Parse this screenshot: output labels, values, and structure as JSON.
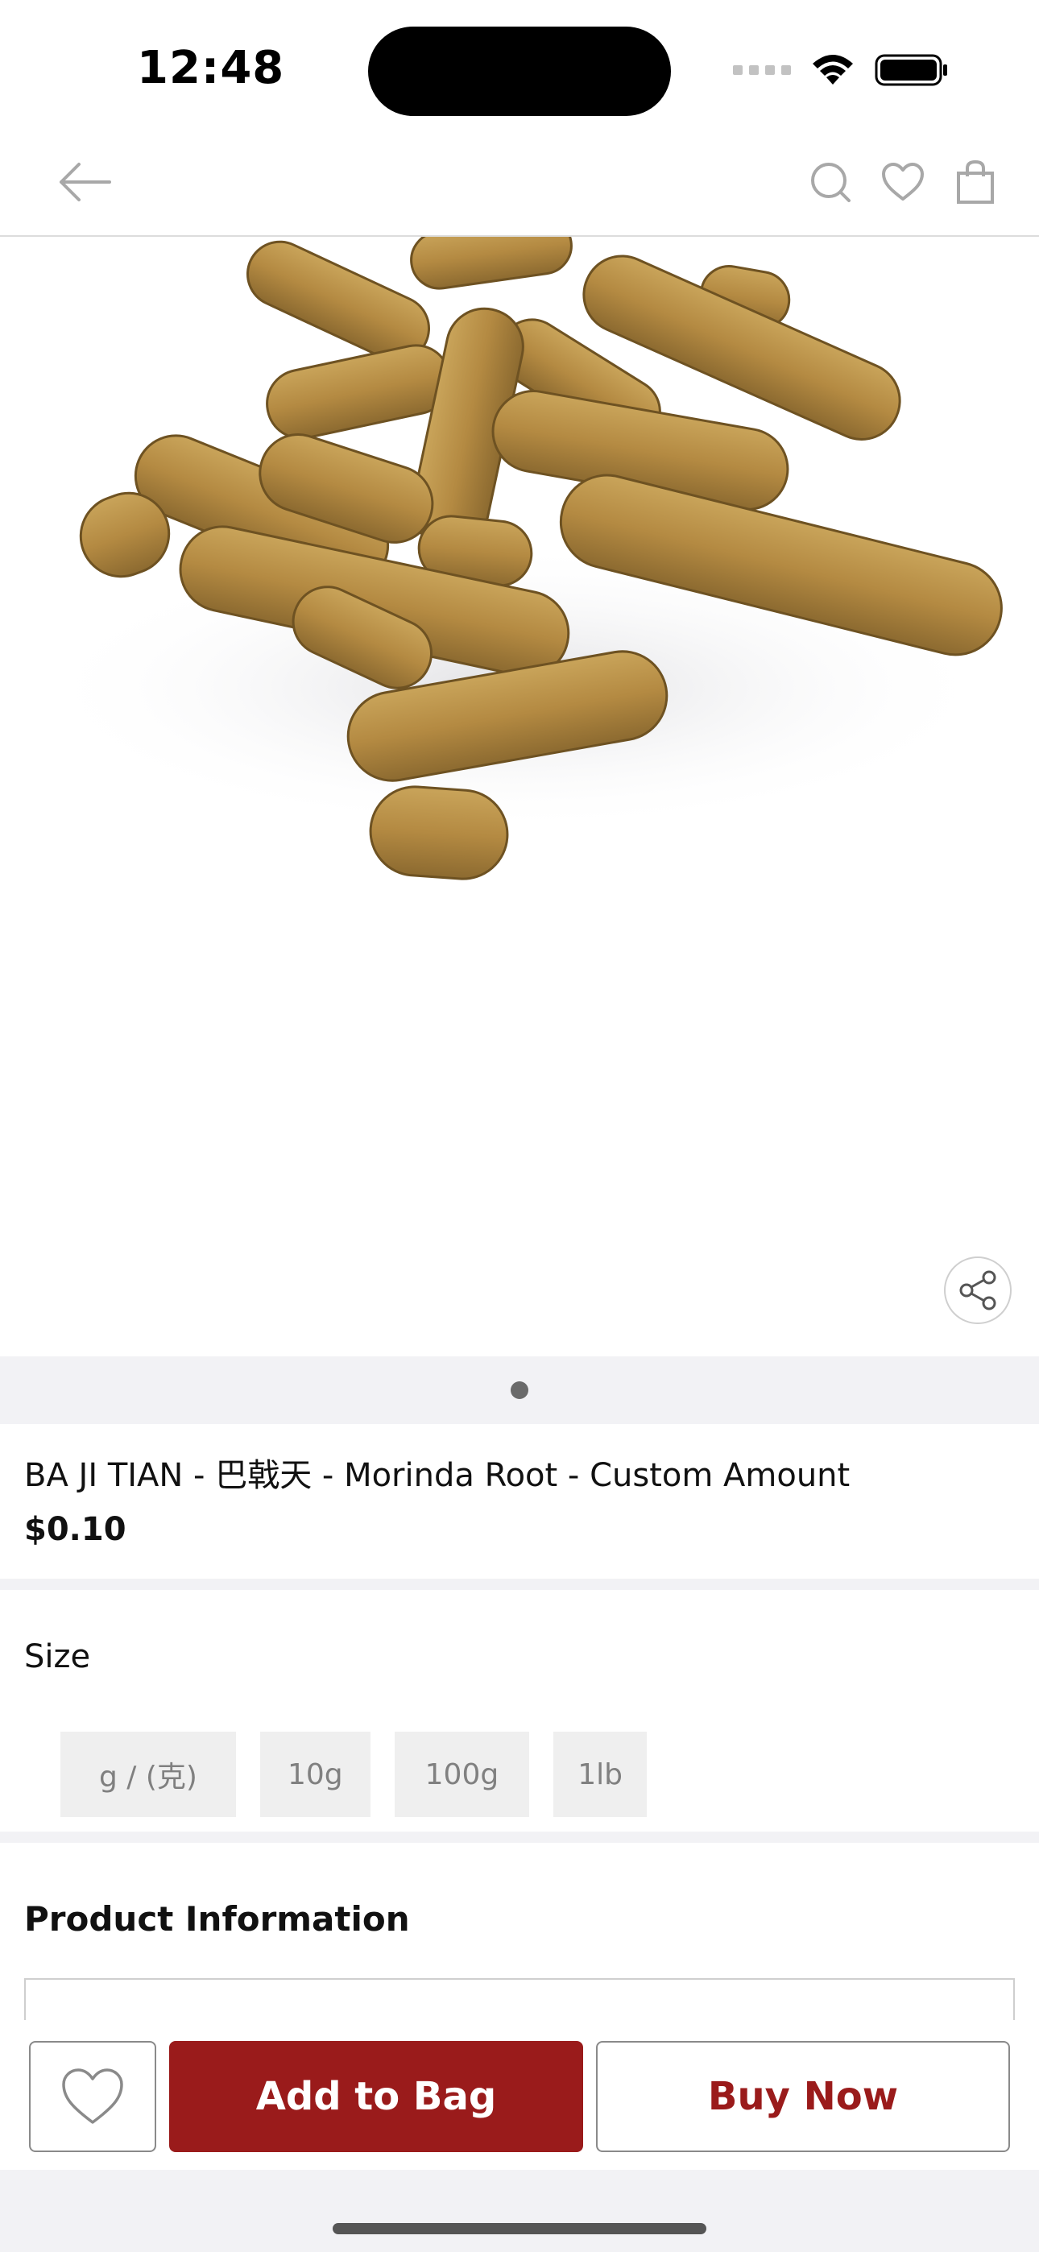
{
  "status_bar": {
    "time": "12:48",
    "icons": [
      "cellular-signal-icon",
      "wifi-icon",
      "battery-icon"
    ]
  },
  "nav": {
    "back_icon": "arrow-left-icon",
    "actions": [
      "search-icon",
      "heart-icon",
      "shopping-bag-icon"
    ]
  },
  "gallery": {
    "image_subject": "dried morinda root pieces",
    "page_index": 1,
    "page_count": 1,
    "share_icon": "share-icon"
  },
  "product": {
    "title": "BA JI TIAN - 巴戟天 - Morinda Root - Custom Amount",
    "price": "$0.10"
  },
  "size": {
    "label": "Size",
    "options": [
      "g / (克)",
      "10g",
      "100g",
      "1lb"
    ]
  },
  "info": {
    "title": "Product Information"
  },
  "actions": {
    "wishlist_icon": "heart-icon",
    "add_to_bag": "Add to Bag",
    "buy_now": "Buy Now"
  },
  "colors": {
    "accent": "#9a1b1b",
    "chip_bg": "#efefef",
    "band_bg": "#f2f2f5"
  }
}
